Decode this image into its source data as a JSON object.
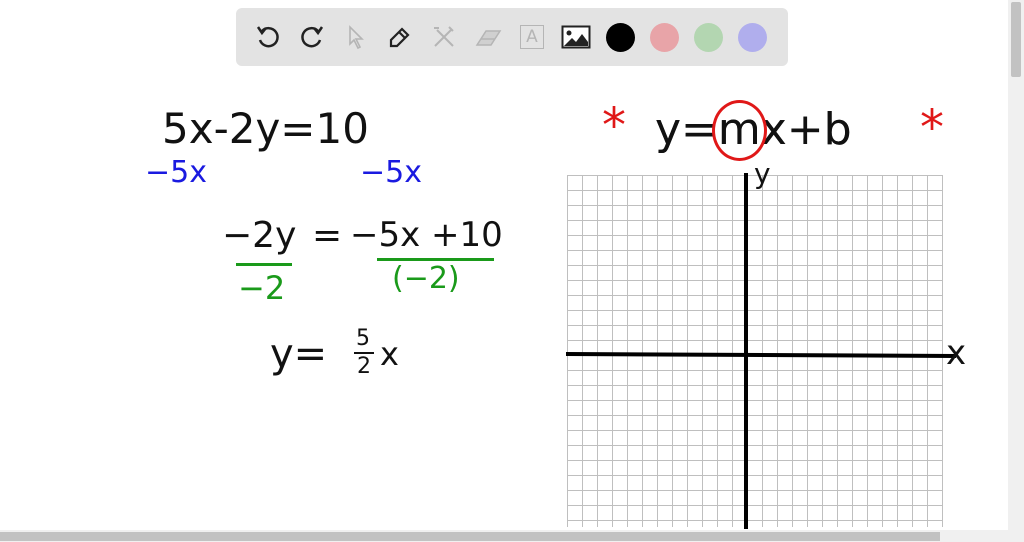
{
  "toolbar": {
    "tools": [
      {
        "icon": "undo-icon",
        "enabled": true
      },
      {
        "icon": "redo-icon",
        "enabled": true
      },
      {
        "icon": "pointer-icon",
        "enabled": false
      },
      {
        "icon": "pencil-icon",
        "enabled": true
      },
      {
        "icon": "tools-icon",
        "enabled": false
      },
      {
        "icon": "eraser-icon",
        "enabled": false
      },
      {
        "icon": "text-icon",
        "enabled": false,
        "label": "A"
      },
      {
        "icon": "image-icon",
        "enabled": true
      }
    ],
    "colors": [
      "#000000",
      "#e8a4a8",
      "#b3d6b1",
      "#b0aeed"
    ],
    "selected_color": "#000000"
  },
  "canvas": {
    "eq1": "5x-2y=10",
    "eq1_left_sub": "−5x",
    "eq1_right_sub": "−5x",
    "eq2_left": "−2y",
    "eq2_eq": "=",
    "eq2_right": "−5x +10",
    "eq2_left_div": "−2",
    "eq2_right_div": "(−2)",
    "eq3_lhs": "y=",
    "eq3_num": "5",
    "eq3_den": "2",
    "eq3_var": "x",
    "slope_form": "y=mx+b",
    "slope_form_pre": "y=",
    "slope_form_m": "m",
    "slope_form_post": "x+b",
    "star": "*",
    "axis_x": "x",
    "axis_y": "y"
  }
}
